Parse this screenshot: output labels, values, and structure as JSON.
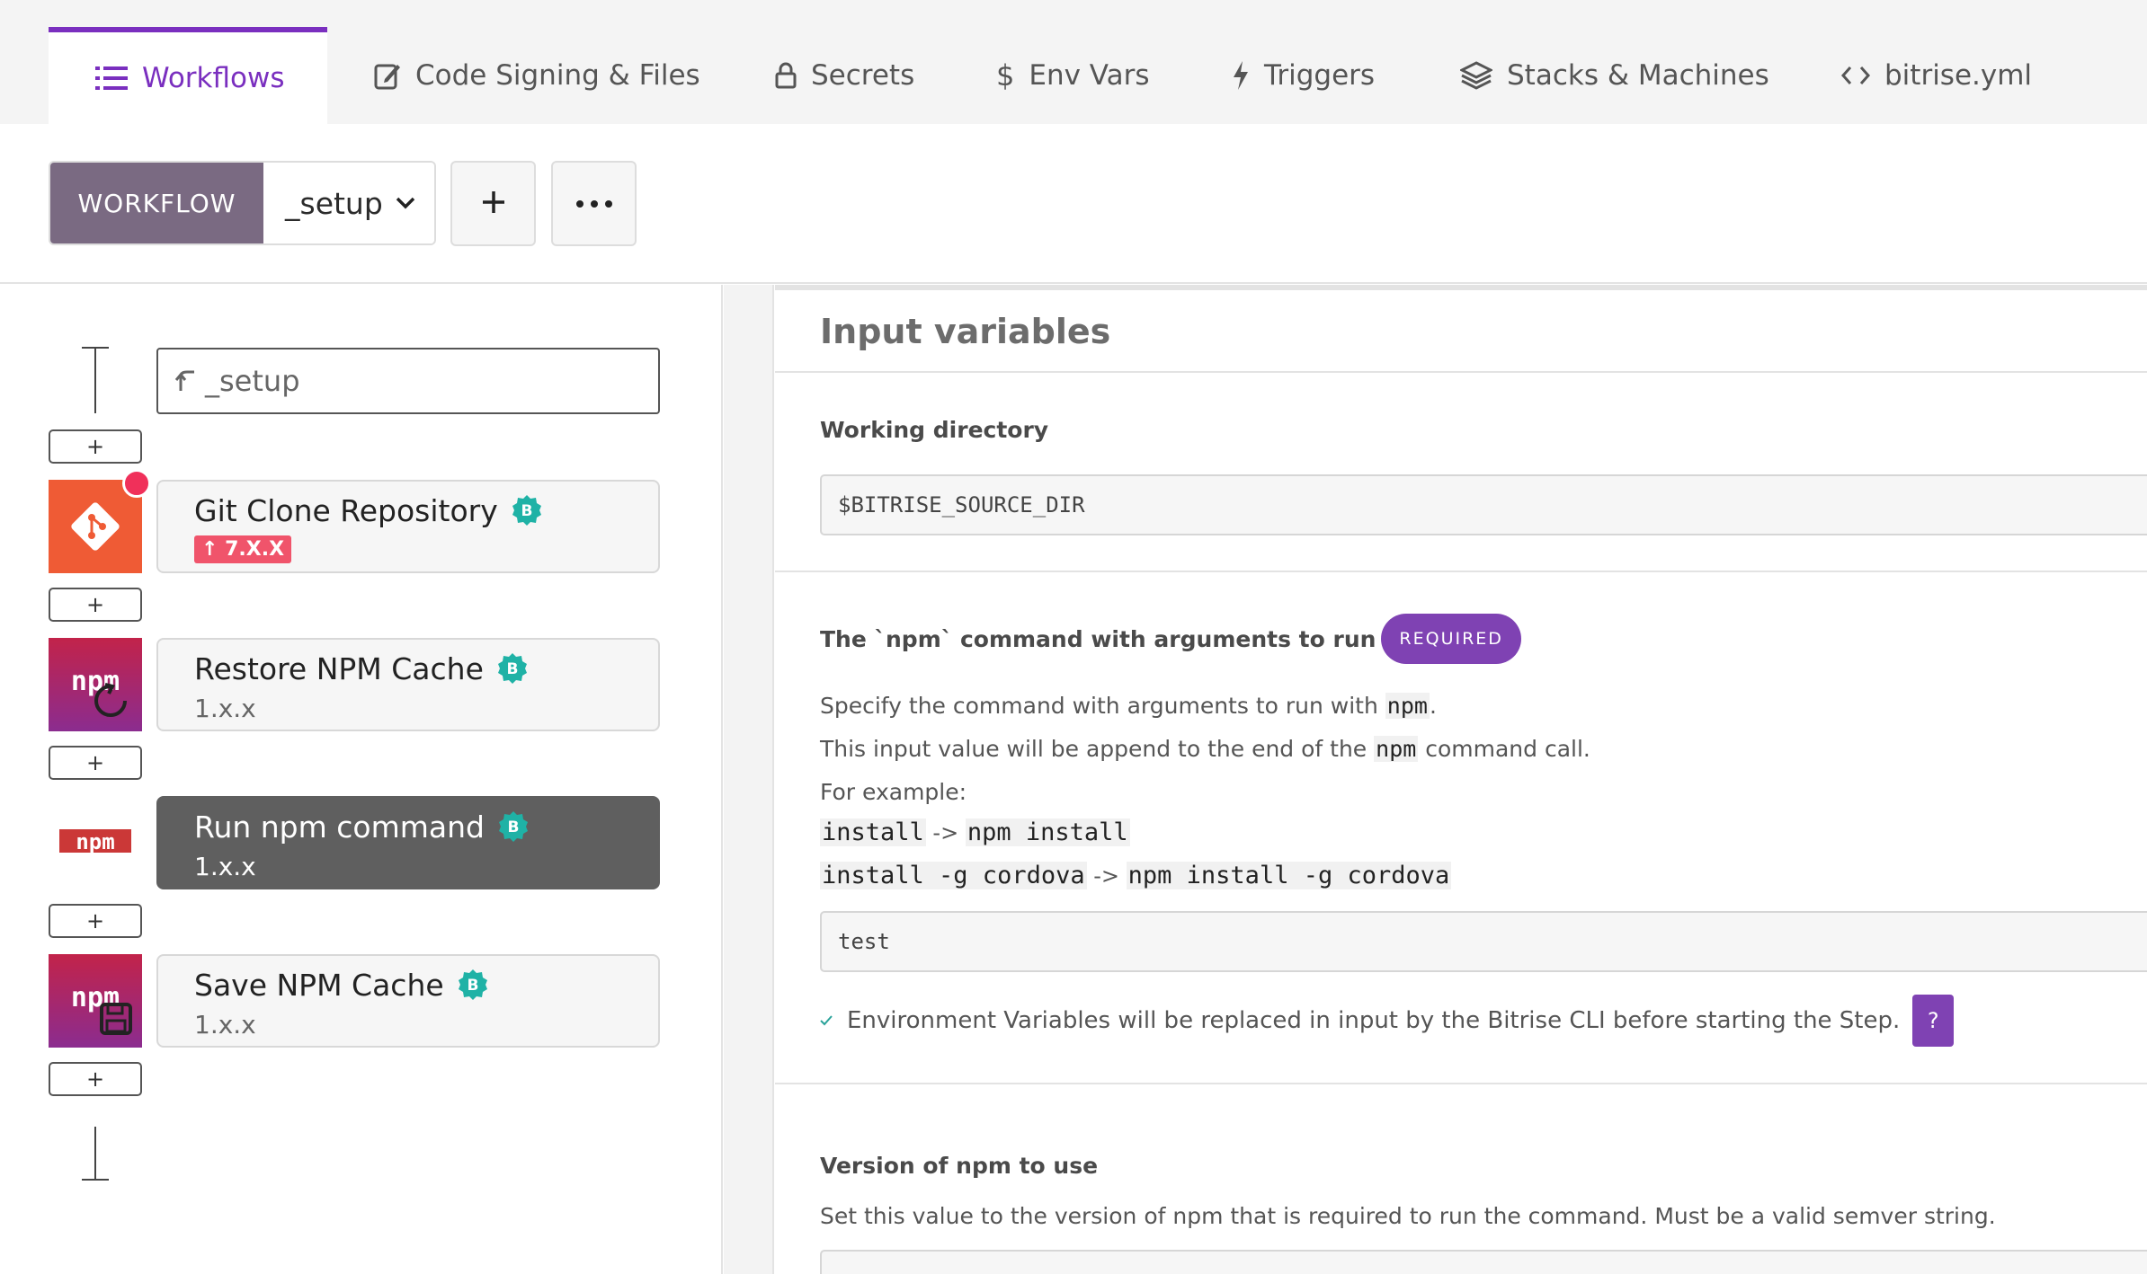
{
  "tabs": [
    {
      "label": "Workflows",
      "icon": "list-icon",
      "active": true
    },
    {
      "label": "Code Signing & Files",
      "icon": "edit-document-icon"
    },
    {
      "label": "Secrets",
      "icon": "lock-icon"
    },
    {
      "label": "Env Vars",
      "icon": "dollar-icon"
    },
    {
      "label": "Triggers",
      "icon": "bolt-icon"
    },
    {
      "label": "Stacks & Machines",
      "icon": "layers-icon"
    },
    {
      "label": "bitrise.yml",
      "icon": "code-icon"
    }
  ],
  "toolbar": {
    "workflow_label": "WORKFLOW",
    "workflow_value": "_setup",
    "add_label": "+",
    "more_label": "•••"
  },
  "pipeline": {
    "start_name": "_setup",
    "plus_label": "+",
    "steps": [
      {
        "title": "Git Clone Repository",
        "version": "↑ 7.X.X",
        "update_available": true,
        "icon": "git-icon",
        "badge": "B"
      },
      {
        "title": "Restore NPM Cache",
        "version": "1.x.x",
        "icon": "npm-restore-icon",
        "badge": "B"
      },
      {
        "title": "Run npm command",
        "version": "1.x.x",
        "icon": "npm-icon",
        "badge": "B",
        "selected": true
      },
      {
        "title": "Save NPM Cache",
        "version": "1.x.x",
        "icon": "npm-save-icon",
        "badge": "B"
      }
    ]
  },
  "inputs": {
    "heading": "Input variables",
    "working_dir": {
      "label": "Working directory",
      "value": "$BITRISE_SOURCE_DIR"
    },
    "npm_command": {
      "label": "The `npm` command with arguments to run",
      "required": "REQUIRED",
      "desc1_pre": "Specify the command with arguments to run with ",
      "desc1_code": "npm",
      "desc1_post": ".",
      "desc2_pre": "This input value will be append to the end of the ",
      "desc2_code": "npm",
      "desc2_post": " command call.",
      "desc3": "For example:",
      "ex1_a": "install",
      "ex1_arrow": " -> ",
      "ex1_b": "npm install",
      "ex2_a": "install -g cordova",
      "ex2_arrow": " -> ",
      "ex2_b": "npm install -g cordova",
      "value": "test",
      "note": "Environment Variables will be replaced in input by the Bitrise CLI before starting the Step.",
      "help": "?"
    },
    "npm_version": {
      "label": "Version of npm to use",
      "desc": "Set this value to the version of npm that is required to run the command. Must be a valid semver string."
    }
  },
  "colors": {
    "accent": "#7a2fbf",
    "git_orange": "#ef5b35",
    "npm_red": "#cb3837",
    "badge_teal": "#1fb2a6",
    "update_red": "#f0546b"
  }
}
